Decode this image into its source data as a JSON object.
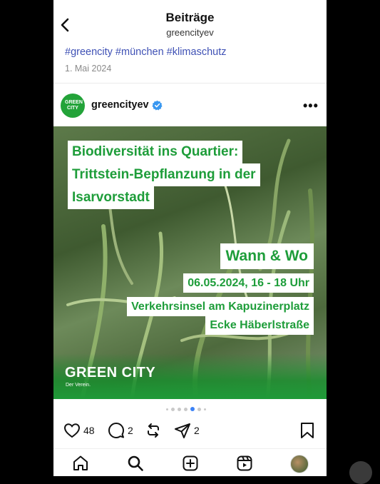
{
  "header": {
    "title": "Beiträge",
    "subtitle": "greencityev"
  },
  "caption": {
    "hashtags": "#greencity #münchen #klimaschutz",
    "date": "1. Mai 2024"
  },
  "post": {
    "username": "greencityev",
    "avatar_text": "GREEN CITY",
    "image_text": {
      "line1": "Biodiversität ins Quartier:",
      "line2": "Trittstein-Bepflanzung in der",
      "line3": "Isarvorstadt",
      "heading": "Wann & Wo",
      "when": "06.05.2024, 16 - 18 Uhr",
      "where1": "Verkehrsinsel am Kapuzinerplatz",
      "where2": "Ecke Häberlstraße",
      "brand": "GREEN CITY",
      "brand_sub": "Der Verein."
    },
    "carousel": {
      "current": 4,
      "total": 7
    },
    "likes": "48",
    "comments": "2",
    "shares": "2"
  },
  "colors": {
    "accent_green": "#1e9d3a",
    "link_blue": "#3f51b5",
    "dot_active": "#3b82f6"
  },
  "icons": {
    "back": "chevron-left-icon",
    "verified": "verified-badge-icon",
    "more": "more-horizontal-icon",
    "like": "heart-icon",
    "comment": "comment-icon",
    "repost": "repost-icon",
    "share": "send-icon",
    "save": "bookmark-icon",
    "home": "home-icon",
    "search": "search-icon",
    "create": "plus-square-icon",
    "reels": "reels-icon"
  }
}
